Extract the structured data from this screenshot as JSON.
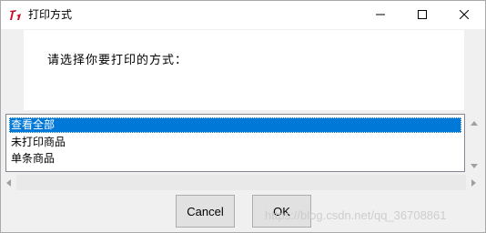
{
  "window": {
    "title": "打印方式"
  },
  "dialog": {
    "message": "请选择你要打印的方式："
  },
  "listbox": {
    "items": [
      {
        "label": "查看全部",
        "selected": true
      },
      {
        "label": "未打印商品",
        "selected": false
      },
      {
        "label": "单条商品",
        "selected": false
      }
    ]
  },
  "buttons": {
    "cancel_label": "Cancel",
    "ok_label": "OK"
  },
  "watermark": "https://blog.csdn.net/qq_36708861",
  "colors": {
    "selection": "#0078d7",
    "app_icon": "#c8102e"
  }
}
